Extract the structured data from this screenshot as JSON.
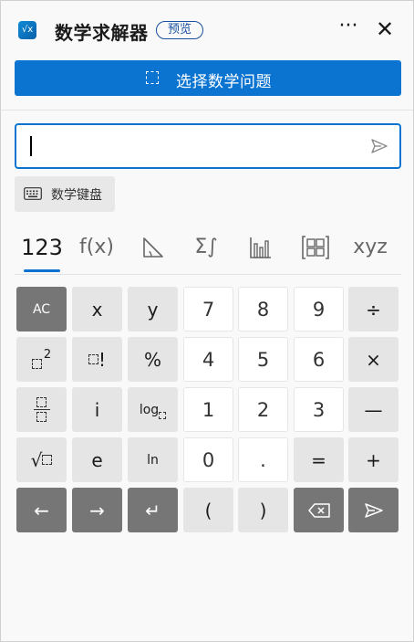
{
  "header": {
    "app_icon": "√x",
    "title": "数学求解器",
    "badge": "预览",
    "more": "···",
    "close": "✕"
  },
  "select_button": {
    "label": "选择数学问题"
  },
  "input": {
    "value": "",
    "placeholder": ""
  },
  "keyboard_button": {
    "label": "数学键盘"
  },
  "tabs": [
    {
      "label": "123",
      "active": true
    },
    {
      "label": "f(x)"
    },
    {
      "label": "triangle-icon"
    },
    {
      "label": "Σ∫"
    },
    {
      "label": "bar-chart-icon"
    },
    {
      "label": "matrix-icon"
    },
    {
      "label": "xyz"
    }
  ],
  "keys": {
    "ac": "AC",
    "x": "x",
    "y": "y",
    "n7": "7",
    "n8": "8",
    "n9": "9",
    "div": "÷",
    "square_exp": "2",
    "fact": "!",
    "percent": "%",
    "n4": "4",
    "n5": "5",
    "n6": "6",
    "mul": "×",
    "i": "i",
    "log": "log",
    "n1": "1",
    "n2": "2",
    "n3": "3",
    "minus": "—",
    "sqrt": "√",
    "e": "e",
    "ln": "ln",
    "n0": "0",
    "dot": ".",
    "eq": "=",
    "plus": "+",
    "left": "←",
    "right": "→",
    "enter": "↵",
    "lparen": "(",
    "rparen": ")"
  }
}
